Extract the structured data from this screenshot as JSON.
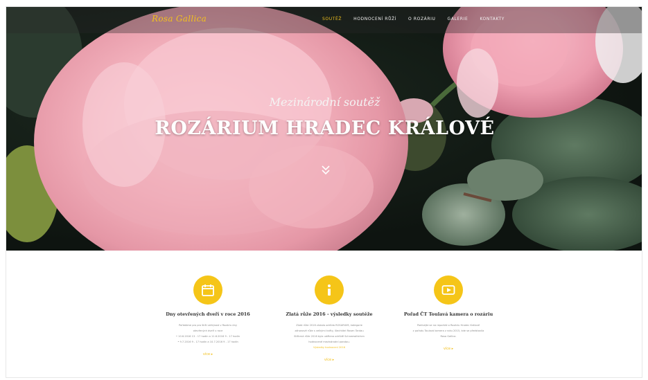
{
  "header": {
    "logo": "Rosa Gallica",
    "nav": [
      {
        "label": "SOUTĚŽ",
        "active": true
      },
      {
        "label": "HODNOCENÍ RŮŽÍ",
        "active": false
      },
      {
        "label": "O ROZÁRIU",
        "active": false
      },
      {
        "label": "GALERIE",
        "active": false
      },
      {
        "label": "KONTAKTY",
        "active": false
      }
    ]
  },
  "hero": {
    "subtitle": "Mezinárodní soutěž",
    "title": "ROZÁRIUM HRADEC KRÁLOVÉ",
    "scroll_icon": "double-chevron-down-icon"
  },
  "cards": [
    {
      "icon": "calendar-icon",
      "title": "Dny otevřených dveří v roce 2016",
      "text_lines": [
        "Pořádáme pro pro širší veřejnost v Rozáriu dny",
        "otevřených dveří v roce",
        "• 10.6.2016 13 - 17 hodin a 11.6.2016 9 - 17 hodin",
        "• 9.7.2016 9 - 17 hodin a 10.7.2016 9 - 17 hodin"
      ],
      "highlight": "",
      "more": "více ▸"
    },
    {
      "icon": "info-icon",
      "title": "Zlatá růže 2016 - výsledky soutěže",
      "text_lines": [
        "Zlatá růže 2016 získala odrůda ROSARIUM, kategorie",
        "záhonové růže s velkými květy, šlechtitel Rosen Tantau",
        "Stříbrná růže 2016 byla udělena odrůdě Schneewittchen",
        "hodnocené mezinárodní porotou."
      ],
      "highlight": "Výsledky hodnocení 2016",
      "more": "více ▸"
    },
    {
      "icon": "play-icon",
      "title": "Pořad ČT Toulavá kamera o rozáriu",
      "text_lines": [
        "Podívejte se na reportáž o Rozáriu Hradec Králové",
        "z pořadu Toulavá kamera z roku 2015, kde se představila",
        "Rosa Gallica."
      ],
      "highlight": "",
      "more": "více ▸"
    }
  ],
  "colors": {
    "accent": "#f5c518",
    "link": "#f2c01e",
    "body_text": "#8a8a8a"
  }
}
